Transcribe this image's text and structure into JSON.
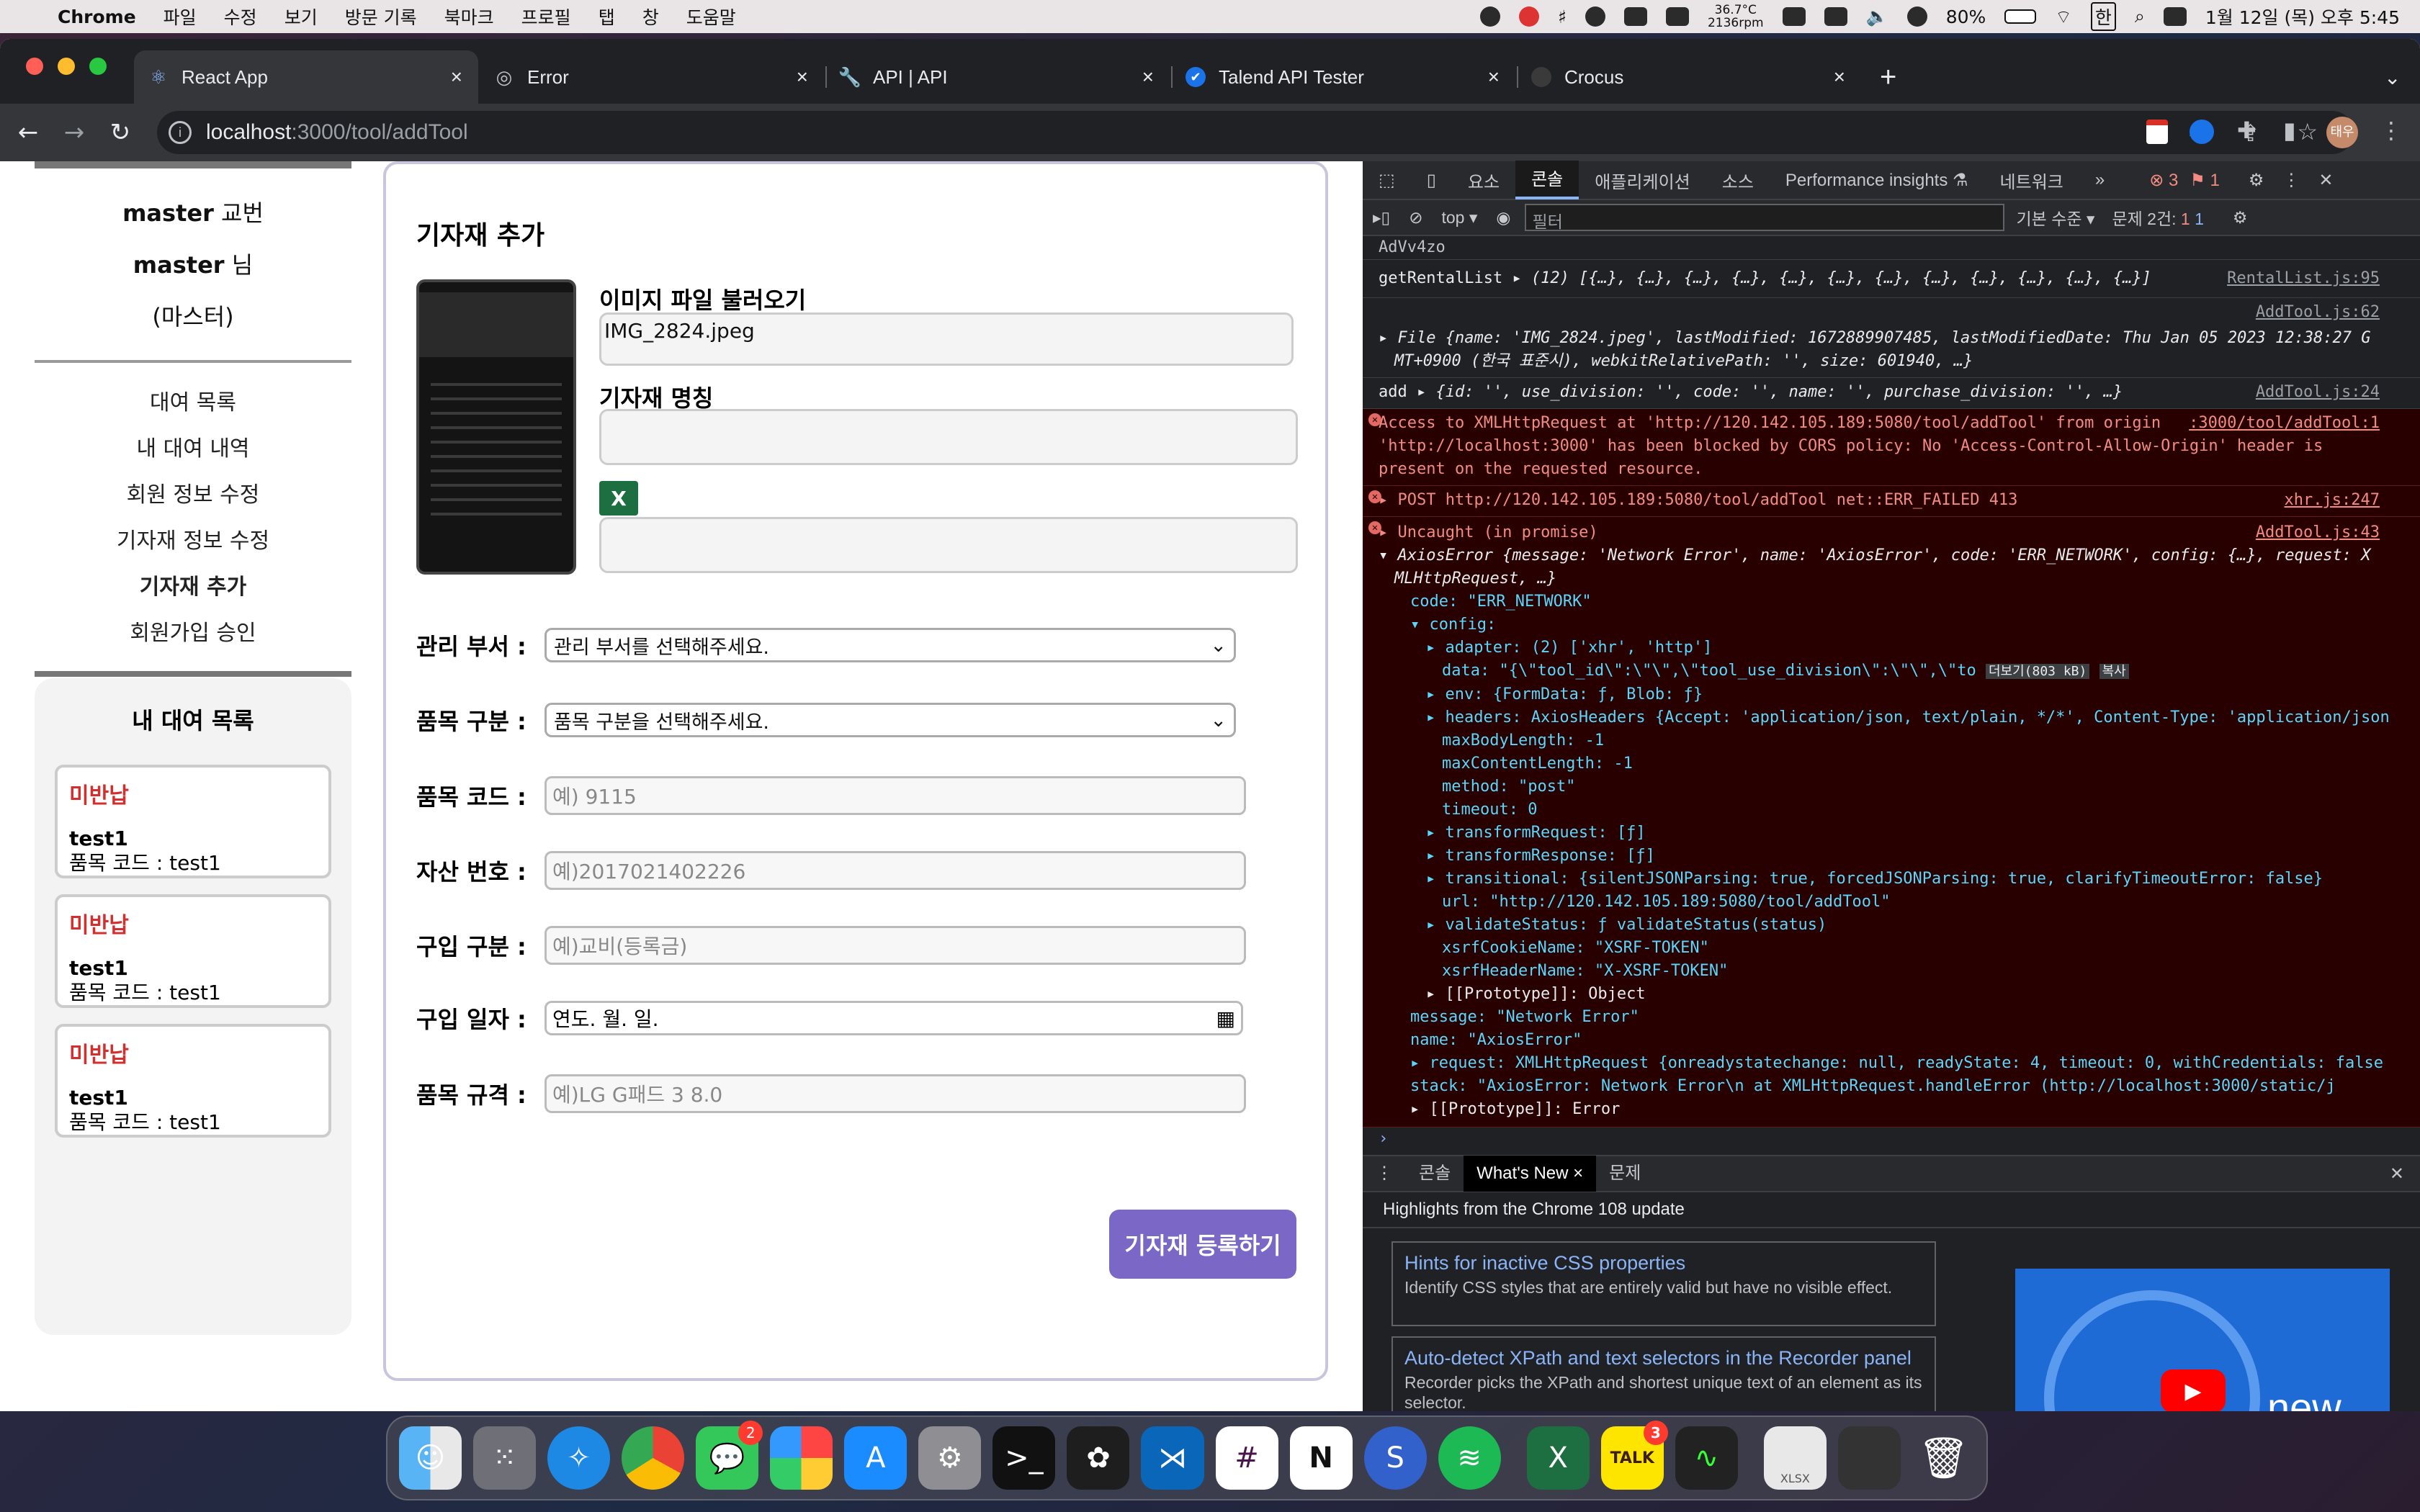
{
  "menubar": {
    "app": "Chrome",
    "items": [
      "파일",
      "수정",
      "보기",
      "방문 기록",
      "북마크",
      "프로필",
      "탭",
      "창",
      "도움말"
    ],
    "temp": "36.7°C",
    "rpm": "2136rpm",
    "battery": "80%",
    "ime": "한",
    "clock": "1월 12일 (목) 오후 5:45"
  },
  "tabs": [
    {
      "title": "React App",
      "icon": "⚛"
    },
    {
      "title": "Error",
      "icon": "◎"
    },
    {
      "title": "API | API",
      "icon": "🔧"
    },
    {
      "title": "Talend API Tester",
      "icon": "✔"
    },
    {
      "title": "Crocus",
      "icon": ""
    }
  ],
  "url": {
    "host": "localhost",
    "path": ":3000/tool/addTool"
  },
  "profile": "태우",
  "sidebar": {
    "user_id": "master",
    "role_suffix": "교번",
    "user_name": "master",
    "name_suffix": "님",
    "role": "(마스터)",
    "menu": [
      "대여 목록",
      "내 대여 내역",
      "회원 정보 수정",
      "기자재 정보 수정",
      "기자재 추가",
      "회원가입 승인"
    ],
    "list_title": "내 대여 목록",
    "cards": [
      {
        "status": "미반납",
        "name": "test1",
        "code": "품목 코드 : test1"
      },
      {
        "status": "미반납",
        "name": "test1",
        "code": "품목 코드 : test1"
      },
      {
        "status": "미반납",
        "name": "test1",
        "code": "품목 코드 : test1"
      }
    ]
  },
  "form": {
    "title": "기자재 추가",
    "image_label": "이미지 파일 불러오기",
    "image_value": "IMG_2824.jpeg",
    "name_label": "기자재 명칭",
    "dept_label": "관리 부서 :",
    "dept_value": "관리 부서를 선택해주세요.",
    "cat_label": "품목 구분 :",
    "cat_value": "품목 구분을 선택해주세요.",
    "code_label": "품목 코드 :",
    "code_ph": "예) 9115",
    "asset_label": "자산 번호 :",
    "asset_ph": "예)2017021402226",
    "buy_label": "구입 구분 :",
    "buy_ph": "예)교비(등록금)",
    "date_label": "구입 일자 :",
    "date_ph": "연도. 월. 일.",
    "spec_label": "품목 규격 :",
    "spec_ph": "예)LG G패드 3 8.0",
    "submit": "기자재 등록하기"
  },
  "devtools": {
    "tabs": [
      "요소",
      "콘솔",
      "애플리케이션",
      "소스",
      "Performance insights ⚗",
      "네트워크",
      "»"
    ],
    "errors": "3",
    "issues_1": "1",
    "top": "top",
    "filter": "필터",
    "level": "기본 수준",
    "issues": "문제 2건:",
    "issue_err": "1",
    "issue_info": "1",
    "lines": {
      "l0": "AdVv4zo",
      "l1a": "getRentalList",
      "l1b": "▸ (12) [{…}, {…}, {…}, {…}, {…}, {…}, {…}, {…}, {…}, {…}, {…}, {…}]",
      "l1s": "RentalList.js:95",
      "l2s": "AddTool.js:62",
      "l2a": "▸ File {name: 'IMG_2824.jpeg', lastModified: 1672889907485, lastModifiedDate: Thu Jan 05 2023 12:38:27 G",
      "l2b": "MT+0900 (한국 표준시), webkitRelativePath: '', size: 601940, …}",
      "l3a": "add",
      "l3b": "▸ {id: '', use_division: '', code: '', name: '', purchase_division: '', …}",
      "l3s": "AddTool.js:24",
      "e1a": "Access to XMLHttpRequest at 'http://120.142.105.189:5080/tool/addTool' from origin",
      "e1s": ":3000/tool/addTool:1",
      "e1b": "'http://localhost:3000' has been blocked by CORS policy: No 'Access-Control-Allow-Origin' header is",
      "e1c": "present on the requested resource.",
      "e2a": "▸ POST http://120.142.105.189:5080/tool/addTool net::ERR_FAILED 413",
      "e2s": "xhr.js:247",
      "e3a": "▸ Uncaught (in promise)",
      "e3s": "AddTool.js:43",
      "e3b": "▾ AxiosError {message: 'Network Error', name: 'AxiosError', code: 'ERR_NETWORK', config: {…}, request: X",
      "e3c": "MLHttpRequest, …}",
      "c1": "code: \"ERR_NETWORK\"",
      "c2": "▾ config:",
      "c3": "▸ adapter: (2) ['xhr', 'http']",
      "c4": "data: \"{\\\"tool_id\\\":\\\"\\\",\\\"tool_use_division\\\":\\\"\\\",\\\"to",
      "c4b": "더보기(803 kB)",
      "c4c": "복사",
      "c5": "▸ env: {FormData: ƒ, Blob: ƒ}",
      "c6": "▸ headers: AxiosHeaders {Accept: 'application/json, text/plain, */*', Content-Type: 'application/json",
      "c7": "maxBodyLength: -1",
      "c8": "maxContentLength: -1",
      "c9": "method: \"post\"",
      "c10": "timeout: 0",
      "c11": "▸ transformRequest: [ƒ]",
      "c12": "▸ transformResponse: [ƒ]",
      "c13": "▸ transitional: {silentJSONParsing: true, forcedJSONParsing: true, clarifyTimeoutError: false}",
      "c14": "url: \"http://120.142.105.189:5080/tool/addTool\"",
      "c15": "▸ validateStatus: ƒ validateStatus(status)",
      "c16": "xsrfCookieName: \"XSRF-TOKEN\"",
      "c17": "xsrfHeaderName: \"X-XSRF-TOKEN\"",
      "c18": "▸ [[Prototype]]: Object",
      "c19": "message: \"Network Error\"",
      "c20": "name: \"AxiosError\"",
      "c21": "▸ request: XMLHttpRequest {onreadystatechange: null, readyState: 4, timeout: 0, withCredentials: false",
      "c22": "stack: \"AxiosError: Network Error\\n    at XMLHttpRequest.handleError (http://localhost:3000/static/j",
      "c23": "▸ [[Prototype]]: Error"
    },
    "drawer_tabs": [
      "콘솔",
      "What's New",
      "문제"
    ],
    "highlights": "Highlights from the Chrome 108 update",
    "news": [
      {
        "title": "Hints for inactive CSS properties",
        "desc": "Identify CSS styles that are entirely valid but have no visible effect."
      },
      {
        "title": "Auto-detect XPath and text selectors in the Recorder panel",
        "desc": "Recorder picks the XPath and shortest unique text of an element as its selector."
      }
    ],
    "video_text": "new"
  },
  "dock": {
    "messages_badge": "2",
    "talk_badge": "3",
    "xlsx_label": "XLSX"
  }
}
